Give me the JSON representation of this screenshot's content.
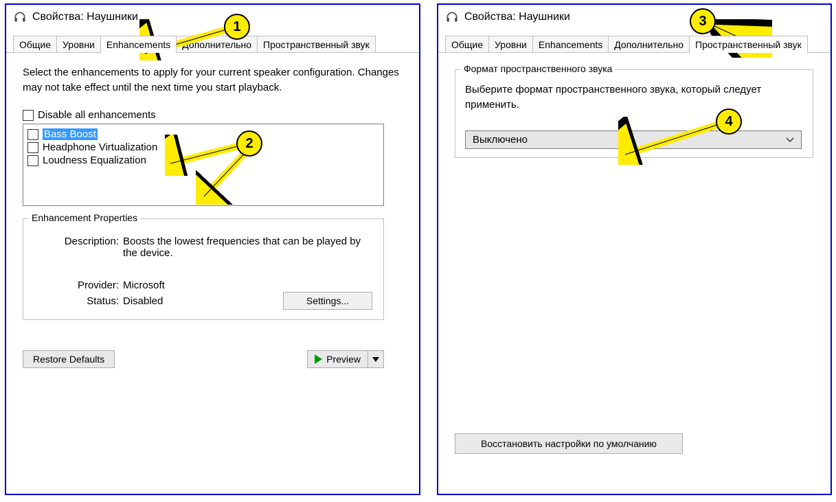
{
  "left": {
    "title": "Свойства: Наушники",
    "tabs": [
      "Общие",
      "Уровни",
      "Enhancements",
      "Дополнительно",
      "Пространственный звук"
    ],
    "active_tab": 2,
    "intro": "Select the enhancements to apply for your current speaker configuration. Changes may not take effect until the next time you start playback.",
    "disable_all_label": "Disable all enhancements",
    "enhancements": [
      "Bass Boost",
      "Headphone Virtualization",
      "Loudness Equalization"
    ],
    "selected_index": 0,
    "group_title": "Enhancement Properties",
    "desc_label": "Description:",
    "desc_value": "Boosts the lowest frequencies that can be played by the device.",
    "provider_label": "Provider:",
    "provider_value": "Microsoft",
    "status_label": "Status:",
    "status_value": "Disabled",
    "settings_btn": "Settings...",
    "restore_btn": "Restore Defaults",
    "preview_btn": "Preview"
  },
  "right": {
    "title": "Свойства: Наушники",
    "tabs": [
      "Общие",
      "Уровни",
      "Enhancements",
      "Дополнительно",
      "Пространственный звук"
    ],
    "active_tab": 4,
    "group_title": "Формат пространственного звука",
    "desc": "Выберите формат пространственного звука, который следует применить.",
    "combo_value": "Выключено",
    "restore_btn": "Восстановить настройки по умолчанию"
  },
  "callouts": {
    "n1": "1",
    "n2": "2",
    "n3": "3",
    "n4": "4"
  }
}
